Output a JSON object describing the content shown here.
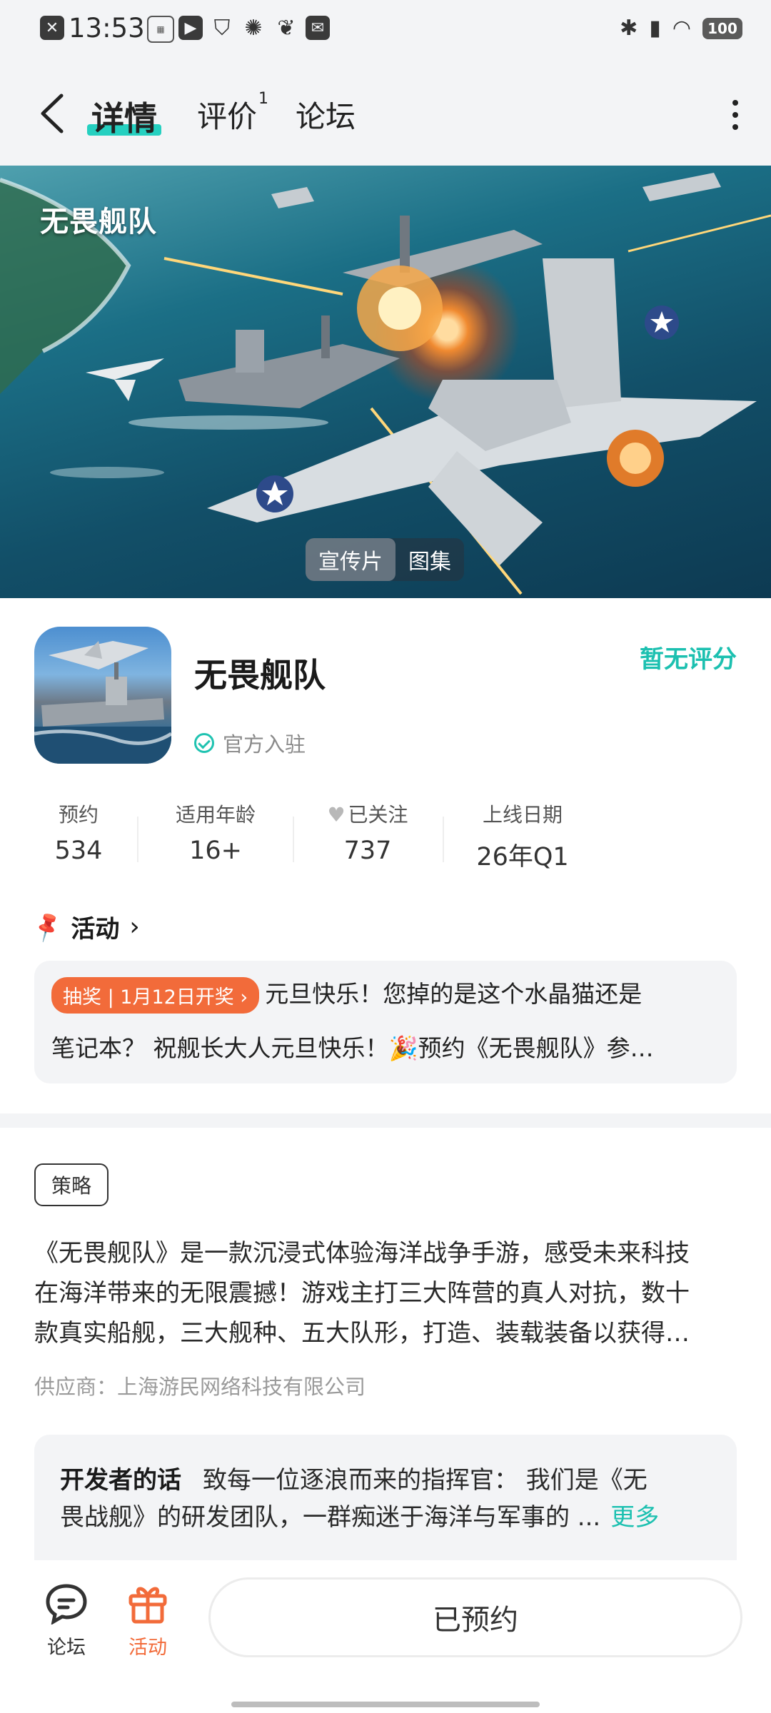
{
  "status_bar": {
    "time": "13:53",
    "battery": "100"
  },
  "header": {
    "tabs": [
      {
        "label": "详情"
      },
      {
        "label": "评价",
        "badge": "1"
      },
      {
        "label": "论坛"
      }
    ]
  },
  "hero": {
    "logo_text": "无畏舰队",
    "media_tabs": [
      "宣传片",
      "图集"
    ]
  },
  "app": {
    "name": "无畏舰队",
    "rating": "暂无评分",
    "official": "官方入驻"
  },
  "stats": [
    {
      "label": "预约",
      "value": "534"
    },
    {
      "label": "适用年龄",
      "value": "16+"
    },
    {
      "label": "已关注",
      "value": "737"
    },
    {
      "label": "上线日期",
      "value": "26年Q1"
    }
  ],
  "activity": {
    "heading": "活动",
    "badge": "抽奖 | 1月12日开奖 ›",
    "line1": "元旦快乐！您掉的是这个水晶猫还是",
    "line2": "笔记本？ 祝舰长大人元旦快乐！🎉预约《无畏舰队》参…"
  },
  "description": {
    "tag": "策略",
    "lines": [
      "《无畏舰队》是一款沉浸式体验海洋战争手游，感受未来科技",
      "在海洋带来的无限震撼！游戏主打三大阵营的真人对抗，数十",
      "款真实船舰，三大舰种、五大队形，打造、装载装备以获得…"
    ],
    "supplier": "供应商：上海游民网络科技有限公司"
  },
  "developer": {
    "title": "开发者的话",
    "line1": "致每一位逐浪而来的指挥官： 我们是《无",
    "line2": "畏战舰》的研发团队，一群痴迷于海洋与军事的 ...",
    "more": "更多"
  },
  "bottom_bar": {
    "forum_label": "论坛",
    "activity_label": "活动",
    "reserve_button": "已预约"
  },
  "colors": {
    "accent": "#1cc0b0",
    "orange": "#f26b3a"
  }
}
